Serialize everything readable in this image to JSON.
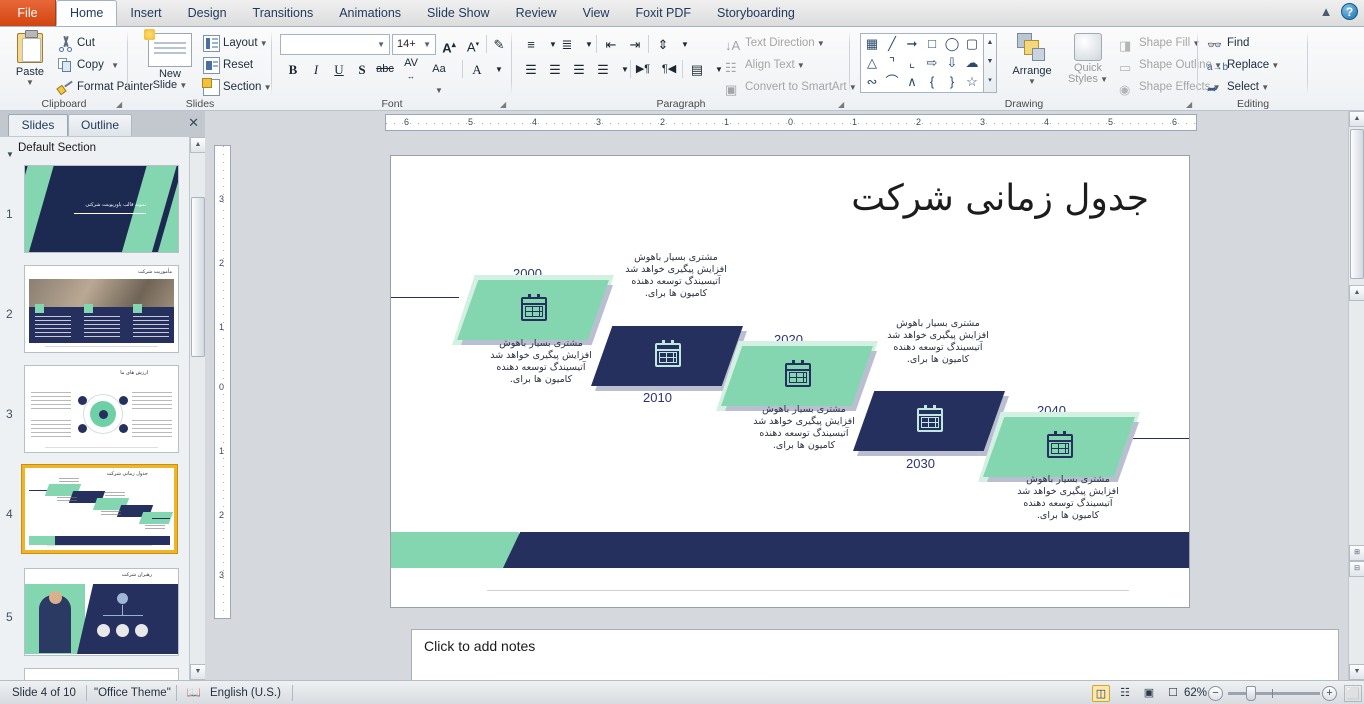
{
  "window": {
    "help_icon": "help-icon",
    "minimize_icon": "minimize-ribbon-icon"
  },
  "tabs": [
    {
      "label": "File",
      "key": "file"
    },
    {
      "label": "Home",
      "key": "home"
    },
    {
      "label": "Insert",
      "key": "insert"
    },
    {
      "label": "Design",
      "key": "design"
    },
    {
      "label": "Transitions",
      "key": "transitions"
    },
    {
      "label": "Animations",
      "key": "animations"
    },
    {
      "label": "Slide Show",
      "key": "slideshow"
    },
    {
      "label": "Review",
      "key": "review"
    },
    {
      "label": "View",
      "key": "view"
    },
    {
      "label": "Foxit PDF",
      "key": "foxitpdf"
    },
    {
      "label": "Storyboarding",
      "key": "storyboarding"
    }
  ],
  "active_tab": "Home",
  "ribbon": {
    "clipboard": {
      "group_label": "Clipboard",
      "paste": "Paste",
      "cut": "Cut",
      "copy": "Copy",
      "format_painter": "Format Painter"
    },
    "slides": {
      "group_label": "Slides",
      "new_slide": "New\nSlide",
      "new_slide_line1": "New",
      "new_slide_line2": "Slide",
      "layout": "Layout",
      "reset": "Reset",
      "section": "Section"
    },
    "font": {
      "group_label": "Font",
      "font_name_value": "",
      "font_size_value": "14+",
      "grow_font": "A",
      "shrink_font": "A",
      "clear_formatting": "clear-formatting-icon",
      "bold": "B",
      "italic": "I",
      "underline": "U",
      "shadow": "S",
      "strikethrough": "abc",
      "character_spacing": "AV",
      "change_case": "Aa",
      "font_color": "A"
    },
    "paragraph": {
      "group_label": "Paragraph",
      "text_direction": "Text Direction",
      "align_text": "Align Text",
      "convert_to_smartart": "Convert to SmartArt"
    },
    "drawing": {
      "group_label": "Drawing",
      "arrange": "Arrange",
      "quick_styles_line1": "Quick",
      "quick_styles_line2": "Styles",
      "shape_fill": "Shape Fill",
      "shape_outline": "Shape Outline",
      "shape_effects": "Shape Effects",
      "shapes": [
        "textbox",
        "line",
        "arrow",
        "rectangle",
        "oval",
        "rounded-rectangle",
        "triangle",
        "elbow-connector",
        "elbow-arrow-connector",
        "right-arrow",
        "down-arrow",
        "cloud",
        "curve-scribble",
        "arc",
        "curve",
        "left-brace",
        "right-brace",
        "star"
      ]
    },
    "editing": {
      "group_label": "Editing",
      "find": "Find",
      "replace": "Replace",
      "select": "Select"
    }
  },
  "left_pane": {
    "tab_slides": "Slides",
    "tab_outline": "Outline",
    "close_icon": "close-panel-icon",
    "section_name": "Default Section",
    "thumbnails": [
      {
        "number": "1",
        "title": "نمونه قالب پاورپوینت شرکتی",
        "kind": "title"
      },
      {
        "number": "2",
        "title": "مأموریت شرکت",
        "kind": "team"
      },
      {
        "number": "3",
        "title": "ارزش های ما",
        "kind": "circle"
      },
      {
        "number": "4",
        "title": "جدول زمانی شرکت",
        "kind": "timeline",
        "selected": true
      },
      {
        "number": "5",
        "title": "رهبران شرکت",
        "kind": "org"
      }
    ]
  },
  "rulers": {
    "horizontal_ticks": [
      "6",
      "5",
      "4",
      "3",
      "2",
      "1",
      "0",
      "1",
      "2",
      "3",
      "4",
      "5",
      "6"
    ],
    "vertical_ticks": [
      "3",
      "2",
      "1",
      "0",
      "1",
      "2",
      "3"
    ]
  },
  "slide": {
    "title": "جدول زمانی شرکت",
    "body_text": "مشتری بسیار باهوش\nافزایش پیگیری خواهد شد\nآتیسیندگ توسعه دهنده\nکامیون ها برای.",
    "body_lines": [
      "مشتری بسیار باهوش",
      "افزایش پیگیری خواهد شد",
      "آتیسیندگ توسعه دهنده",
      "کامیون ها برای."
    ],
    "milestones": [
      {
        "year": "2000",
        "color": "green",
        "icon": "calendar-icon"
      },
      {
        "year": "2010",
        "color": "navy",
        "icon": "calendar-icon"
      },
      {
        "year": "2020",
        "color": "green",
        "icon": "calendar-icon"
      },
      {
        "year": "2030",
        "color": "navy",
        "icon": "calendar-icon"
      },
      {
        "year": "2040",
        "color": "green",
        "icon": "calendar-icon"
      }
    ],
    "colors": {
      "green": "#84d6b0",
      "green_light": "#d4f0e3",
      "navy": "#25305f",
      "shadow": "#b9bfd0",
      "year_text": "#2b3470"
    }
  },
  "notes": {
    "placeholder": "Click to add notes"
  },
  "status": {
    "slide_counter": "Slide 4 of 10",
    "theme": "\"Office Theme\"",
    "spellcheck_icon": "spellcheck-icon",
    "language": "English (U.S.)",
    "zoom_value": "62%",
    "zoom_out": "−",
    "zoom_in": "+",
    "fit_icon": "fit-slide-to-window-icon",
    "views": [
      {
        "name": "normal-view",
        "active": true
      },
      {
        "name": "slide-sorter-view",
        "active": false
      },
      {
        "name": "reading-view",
        "active": false
      },
      {
        "name": "slide-show-view",
        "active": false
      }
    ]
  }
}
